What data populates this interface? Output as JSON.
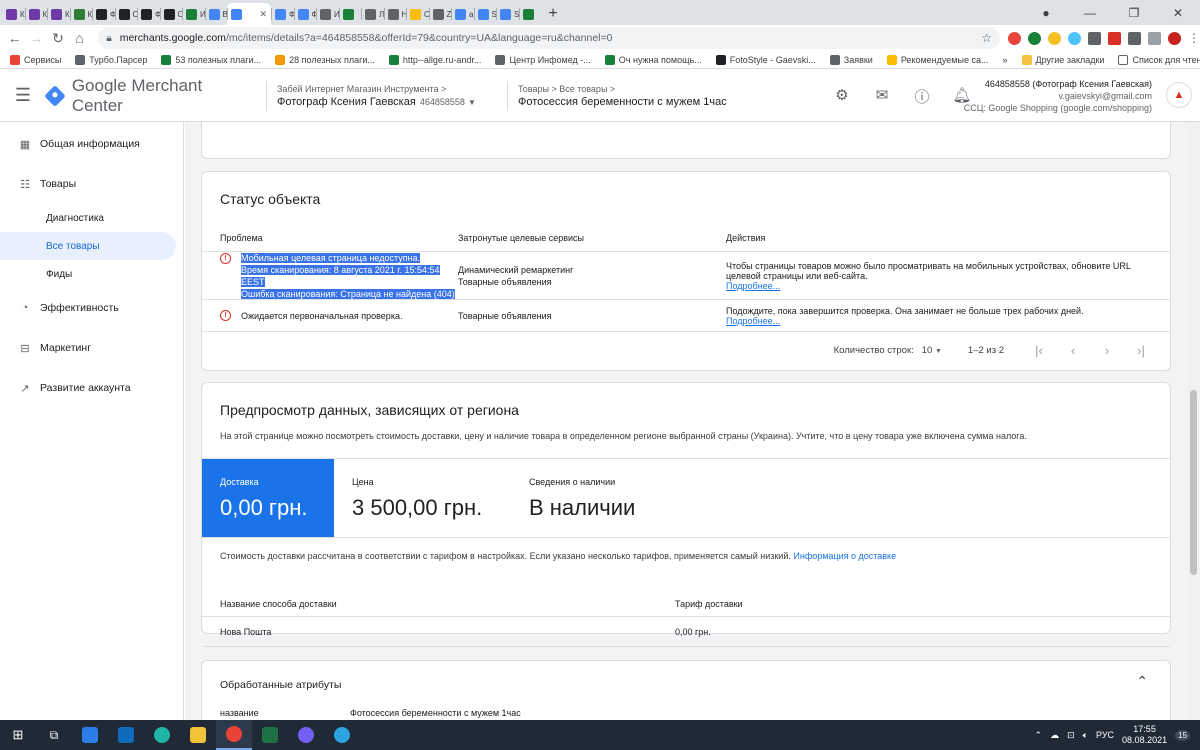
{
  "browser": {
    "tabs": [
      {
        "label": "Каб",
        "icon": "purple-square-icon",
        "color": "#6f3aa8"
      },
      {
        "label": "Каб",
        "icon": "purple-square-icon",
        "color": "#6f3aa8"
      },
      {
        "label": "Каб",
        "icon": "purple-square-icon",
        "color": "#6f3aa8"
      },
      {
        "label": "Куп",
        "icon": "tools-icon",
        "color": "#2e7d32"
      },
      {
        "label": "Фил",
        "icon": "hd-icon",
        "color": "#202124"
      },
      {
        "label": "Сер",
        "icon": "hd-icon",
        "color": "#202124"
      },
      {
        "label": "Фил",
        "icon": "hd-icon",
        "color": "#202124"
      },
      {
        "label": "Смс",
        "icon": "hd-icon",
        "color": "#202124"
      },
      {
        "label": "Ин",
        "icon": "sheets-icon",
        "color": "#188038"
      },
      {
        "label": "Все",
        "icon": "merchant-icon",
        "color": "#4285f4"
      },
      {
        "label": "",
        "icon": "merchant-icon",
        "color": "#4285f4",
        "active": true
      },
      {
        "label": "Фот",
        "icon": "merchant-icon",
        "color": "#4285f4"
      },
      {
        "label": "Фот",
        "icon": "merchant-icon",
        "color": "#4285f4"
      },
      {
        "label": "Ин",
        "icon": "globe-icon",
        "color": "#5f6368"
      },
      {
        "label": "",
        "icon": "sheets-icon",
        "color": "#188038"
      },
      {
        "label": "Лон",
        "icon": "globe-icon",
        "color": "#5f6368"
      },
      {
        "label": "Нас",
        "icon": "globe-icon",
        "color": "#5f6368"
      },
      {
        "label": "Об",
        "icon": "ads-icon",
        "color": "#fbbc04"
      },
      {
        "label": "Za-",
        "icon": "globe-icon",
        "color": "#5f6368"
      },
      {
        "label": "ana",
        "icon": "google-icon",
        "color": "#4285f4"
      },
      {
        "label": "SEO",
        "icon": "merchant-icon",
        "color": "#4285f4"
      },
      {
        "label": "Serp",
        "icon": "merchant-icon",
        "color": "#4285f4"
      },
      {
        "label": "",
        "icon": "sheets-icon",
        "color": "#188038"
      }
    ],
    "url_host": "merchants.google.com",
    "url_path": "/mc/items/details?a=464858558&offerId=79&country=UA&language=ru&channel=0",
    "bookmarks": [
      {
        "label": "Сервисы",
        "color": "#ea4335"
      },
      {
        "label": "Турбо.Парсер",
        "color": "#5f6368"
      },
      {
        "label": "53 полезных плаги...",
        "color": "#188038"
      },
      {
        "label": "28 полезных плаги...",
        "color": "#f29900"
      },
      {
        "label": "http--allge.ru-andr...",
        "color": "#188038"
      },
      {
        "label": "Центр Инфомед -...",
        "color": "#5f6368"
      },
      {
        "label": "Оч нужна помощь...",
        "color": "#188038"
      },
      {
        "label": "FotoStyle - Gaevski...",
        "color": "#202124"
      },
      {
        "label": "Заявки",
        "color": "#5f6368"
      },
      {
        "label": "Рекомендуемые са...",
        "color": "#fbbc04"
      }
    ],
    "bookmarks_more": "»",
    "bookmarks_other": "Другие закладки",
    "bookmarks_reading": "Список для чтения"
  },
  "header": {
    "product_name": "Google Merchant Center",
    "account_small": "Забей Интернет Магазин Инструмента",
    "account_name": "Фотограф Ксения Гаевская",
    "account_id": "464858558",
    "crumbs_small": "Товары  >  Все товары",
    "crumbs_title": "Фотосессия беременности с мужем 1час",
    "user_line1": "464858558 (Фотограф Ксения Гаевская)",
    "user_line2": "v.gaievskyi@gmail.com",
    "user_line3": "CCЦ: Google Shopping (google.com/shopping)"
  },
  "sidebar": {
    "items": [
      {
        "label": "Общая информация",
        "icon": "dashboard-icon"
      },
      {
        "label": "Товары",
        "icon": "list-icon"
      },
      {
        "label": "Эффективность",
        "icon": "progress-icon"
      },
      {
        "label": "Маркетинг",
        "icon": "bag-icon"
      },
      {
        "label": "Развитие аккаунта",
        "icon": "trend-icon"
      }
    ],
    "sub_items": [
      {
        "label": "Диагностика"
      },
      {
        "label": "Все товары"
      },
      {
        "label": "Фиды"
      }
    ]
  },
  "status": {
    "title": "Статус объекта",
    "col_problem": "Проблема",
    "col_services": "Затронутые целевые сервисы",
    "col_actions": "Действия",
    "rows": [
      {
        "problem_lines": [
          "Мобильная целевая страница недоступна.",
          "Время сканирования:  8 августа 2021 г. 15:54:54 EEST",
          "Ошибка сканирования:  Страница не найдена (404)"
        ],
        "services": [
          "Динамический ремаркетинг",
          "Товарные объявления"
        ],
        "action": "Чтобы страницы товаров можно было просматривать на мобильных устройствах, обновите URL целевой страницы или веб-сайта.",
        "link": "Подробнее..."
      },
      {
        "problem_lines": [
          "Ожидается первоначальная проверка."
        ],
        "services": [
          "Товарные объявления"
        ],
        "action": "Подождите, пока завершится проверка. Она занимает не больше трех рабочих дней.",
        "link": "Подробнее..."
      }
    ],
    "rows_label": "Количество строк:",
    "rows_value": "10",
    "range": "1–2 из 2"
  },
  "region": {
    "title": "Предпросмотр данных, зависящих от региона",
    "description": "На этой странице можно посмотреть стоимость доставки, цену и наличие товара в определенном регионе выбранной страны (Украина). Учтите, что в цену товара уже включена сумма налога.",
    "shipping_label": "Доставка",
    "shipping_value": "0,00 грн.",
    "price_label": "Цена",
    "price_value": "3 500,00 грн.",
    "availability_label": "Сведения о наличии",
    "availability_value": "В наличии",
    "note": "Стоимость доставки рассчитана в соответствии с тарифом в настройках. Если указано несколько тарифов, применяется самый низкий.",
    "note_link": "Информация о доставке",
    "col_method": "Название способа доставки",
    "col_rate": "Тариф доставки",
    "method": "Нова Пошта",
    "rate": "0,00 грн."
  },
  "attributes": {
    "title": "Обработанные атрибуты",
    "attr_name": "название",
    "attr_value": "Фотосессия беременности с мужем 1час"
  },
  "taskbar": {
    "lang": "РУС",
    "time": "17:55",
    "date": "08.08.2021",
    "notif_count": "15"
  }
}
